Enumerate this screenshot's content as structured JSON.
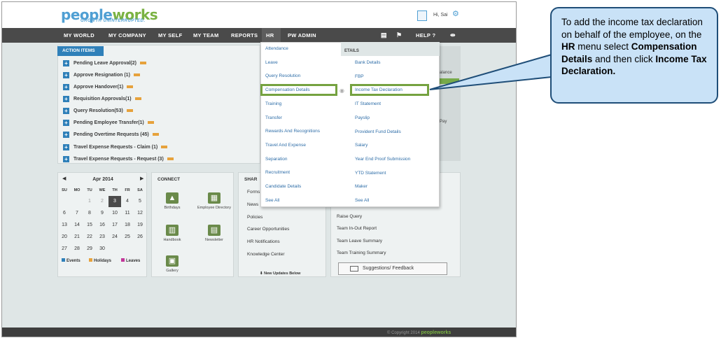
{
  "header": {
    "logo_main": "peopleworks",
    "logo_part1": "people",
    "logo_part2": "works",
    "tagline": "GROWTH UNINTERRUPTED.",
    "greeting": "Hi, Sai"
  },
  "nav": [
    "MY WORLD",
    "MY COMPANY",
    "MY SELF",
    "MY TEAM",
    "REPORTS",
    "HR",
    "PW ADMIN"
  ],
  "nav_right": {
    "help": "HELP"
  },
  "action_items": {
    "title": "ACTION ITEMS",
    "items": [
      "Pending Leave Approval(2)",
      "Approve Resignation (1)",
      "Approve Handover(1)",
      "Requisition Approvals(1)",
      "Query Resolution(53)",
      "Pending Employee Transfer(1)",
      "Pending Overtime Requests (45)",
      "Travel Expense Requests - Claim (1)",
      "Travel Expense Requests - Request (3)"
    ]
  },
  "right_panel": {
    "details": "ETAILS",
    "balance": "alance",
    "pay": "Pay"
  },
  "calendar": {
    "month": "Apr 2014",
    "dow": [
      "SU",
      "MO",
      "TU",
      "WE",
      "TH",
      "FR",
      "SA"
    ],
    "rows": [
      [
        "",
        "",
        "1",
        "2",
        "3",
        "4",
        "5"
      ],
      [
        "6",
        "7",
        "8",
        "9",
        "10",
        "11",
        "12"
      ],
      [
        "13",
        "14",
        "15",
        "16",
        "17",
        "18",
        "19"
      ],
      [
        "20",
        "21",
        "22",
        "23",
        "24",
        "25",
        "26"
      ],
      [
        "27",
        "28",
        "29",
        "30",
        "",
        "",
        ""
      ]
    ],
    "selected": "3",
    "legend": [
      {
        "label": "Events",
        "color": "#2f80b9"
      },
      {
        "label": "Holidays",
        "color": "#e6a23c"
      },
      {
        "label": "Leaves",
        "color": "#c2379a"
      }
    ]
  },
  "connect": {
    "title": "CONNECT",
    "items": [
      "Birthdays",
      "Employee Directory",
      "Handbook",
      "Newsletter",
      "Gallery"
    ]
  },
  "share": {
    "title": "SHAR",
    "items": [
      "Forms",
      "News",
      "Policies",
      "Career Opportunities",
      "HR Notifications",
      "Knowledge Center"
    ],
    "new_updates": "New Updates Below"
  },
  "links": {
    "items": [
      "Raise Query",
      "Team In-Out Report",
      "Team Leave Summary",
      "Team Training Summary"
    ],
    "suggestion": "Suggestions/ Feedback"
  },
  "hr_menu": {
    "col1": [
      "Attendance",
      "Leave",
      "Query Resolution",
      "Compensation Details",
      "Training",
      "Transfer",
      "Rewards And Recognitions",
      "Travel And Expense",
      "Separation",
      "Recruitment",
      "Candidate Details",
      "See All"
    ],
    "col2": [
      "Bank Details",
      "FBP",
      "Income Tax Declaration",
      "IT Statement",
      "Payslip",
      "Provident Fund Details",
      "Salary",
      "Year End Proof Submission",
      "YTD Statement",
      "Maker",
      "See All"
    ]
  },
  "footer": {
    "copyright": "© Copyright 2014",
    "brand": "peopleworks"
  },
  "callout": {
    "t1": "To add the income tax declaration on behalf of the employee, on the ",
    "t2": "HR",
    "t3": " menu select ",
    "t4": "Compensation Details",
    "t5": " and then click ",
    "t6": "Income Tax Declaration."
  },
  "colors": {
    "accent": "#2f80b9",
    "highlight": "#75a240",
    "nav_bg": "#4a4a4a",
    "callout_bg": "#c9e2f7"
  }
}
